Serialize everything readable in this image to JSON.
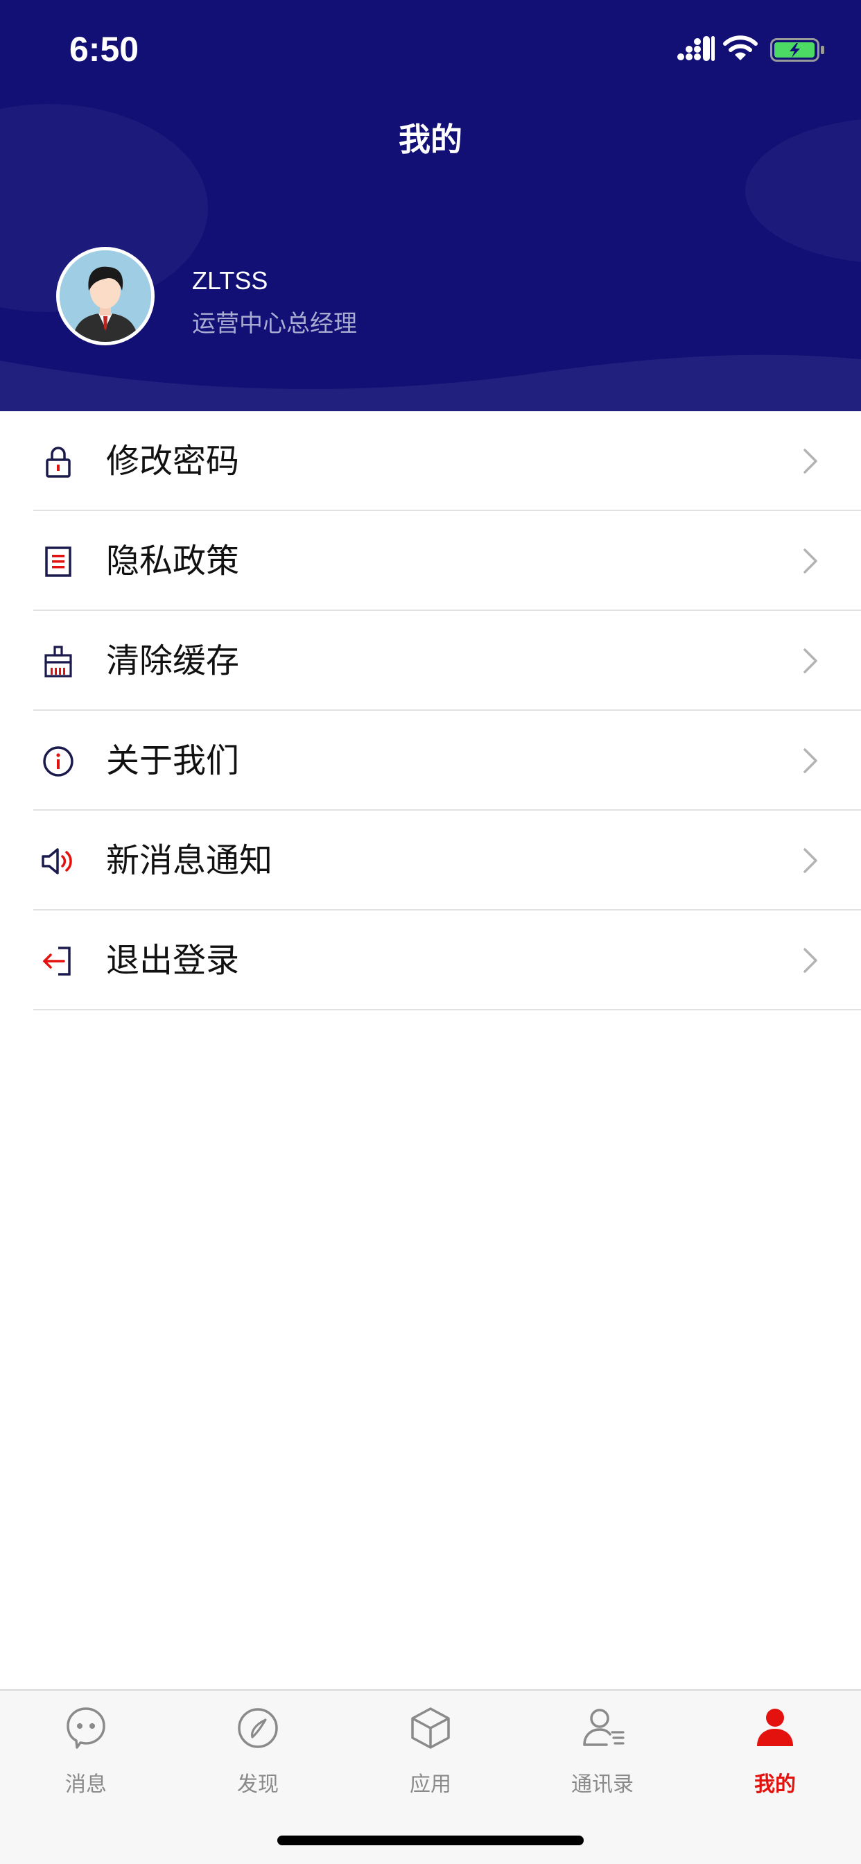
{
  "status_bar": {
    "time": "6:50"
  },
  "header": {
    "title": "我的"
  },
  "profile": {
    "name": "ZLTSS",
    "role": "运营中心总经理"
  },
  "menu": [
    {
      "label": "修改密码",
      "icon": "lock-icon"
    },
    {
      "label": "隐私政策",
      "icon": "document-icon"
    },
    {
      "label": "清除缓存",
      "icon": "broom-icon"
    },
    {
      "label": "关于我们",
      "icon": "info-icon"
    },
    {
      "label": "新消息通知",
      "icon": "speaker-icon"
    },
    {
      "label": "退出登录",
      "icon": "logout-icon"
    }
  ],
  "tabbar": [
    {
      "label": "消息",
      "icon": "chat-bubble-icon",
      "active": false
    },
    {
      "label": "发现",
      "icon": "compass-icon",
      "active": false
    },
    {
      "label": "应用",
      "icon": "cube-icon",
      "active": false
    },
    {
      "label": "通讯录",
      "icon": "contacts-icon",
      "active": false
    },
    {
      "label": "我的",
      "icon": "person-icon",
      "active": true
    }
  ],
  "colors": {
    "header_bg": "#121075",
    "accent_red": "#e3120f",
    "icon_navy": "#1b1a4d",
    "tab_inactive": "#8a8a8a"
  }
}
